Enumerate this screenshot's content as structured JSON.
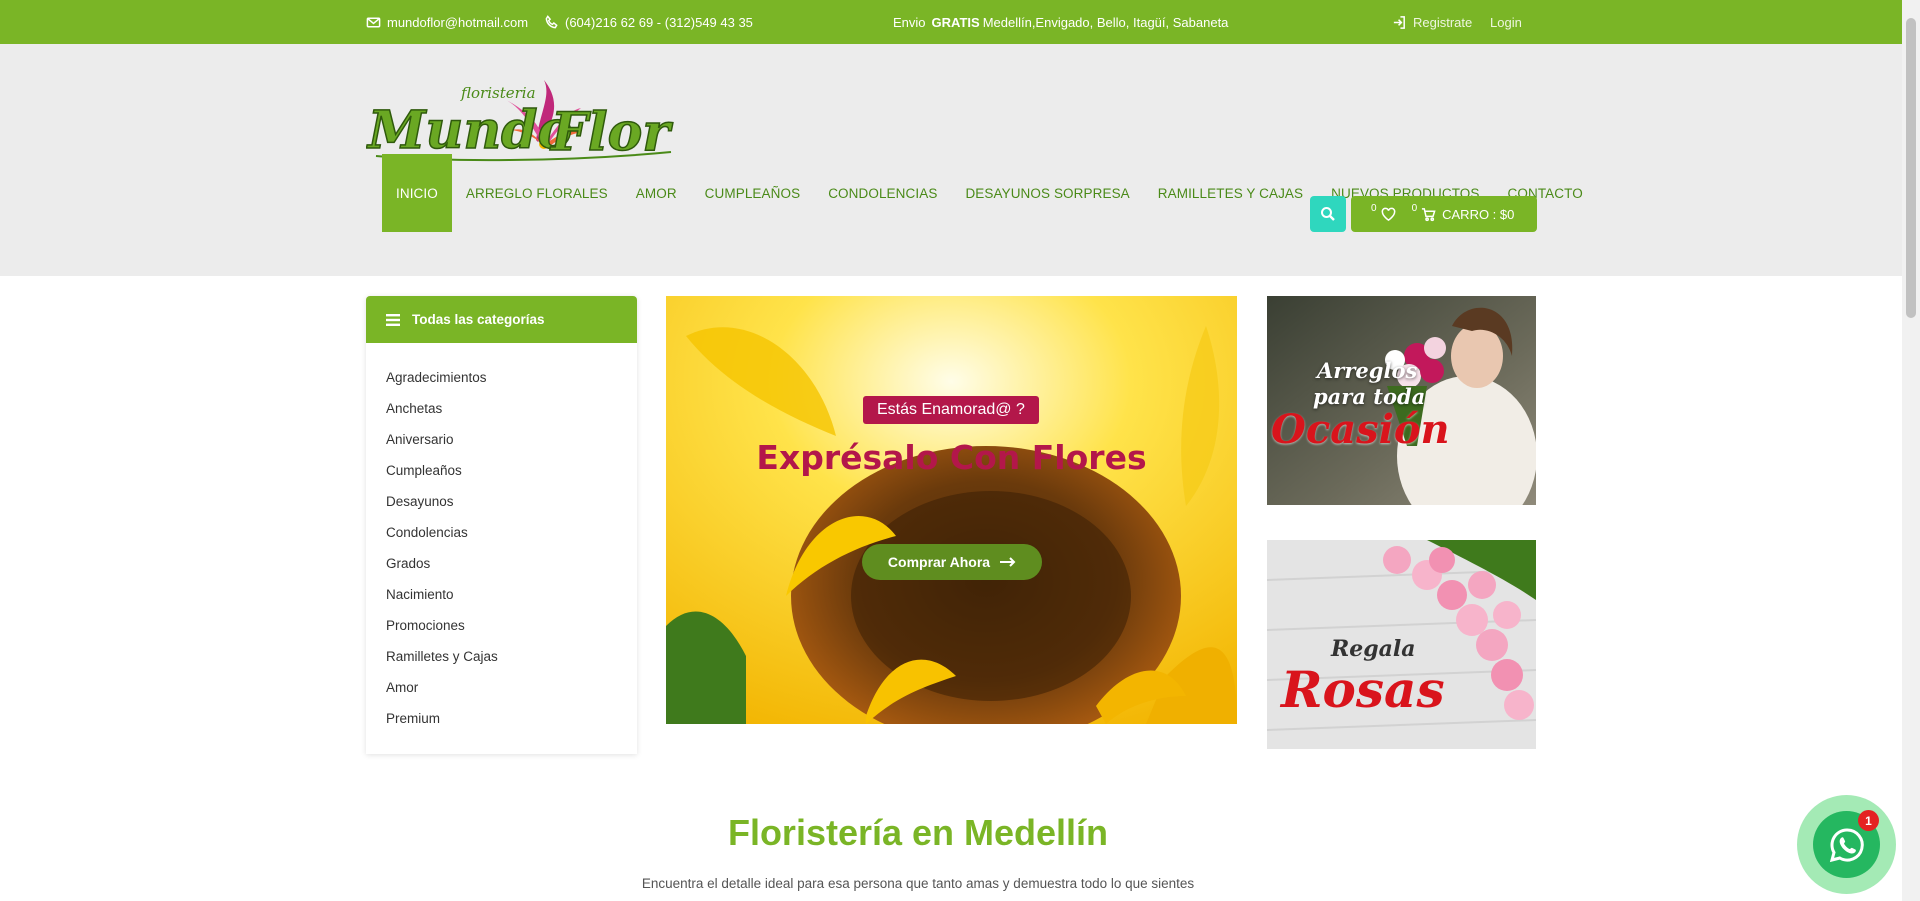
{
  "topbar": {
    "email": "mundoflor@hotmail.com",
    "phone": "(604)216 62 69 - (312)549 43 35",
    "shipping_prefix": "Envio",
    "shipping_bold": "GRATIS",
    "shipping_rest": "Medellín,Envigado, Bello, Itagüí, Sabaneta",
    "register": "Registrate",
    "login": "Login",
    "accent": "#7ab526"
  },
  "logo": {
    "small": "floristeria",
    "main": "Mundo Flor"
  },
  "nav": {
    "items": [
      "INICIO",
      "ARREGLO FLORALES",
      "AMOR",
      "CUMPLEAÑOS",
      "CONDOLENCIAS",
      "DESAYUNOS SORPRESA",
      "RAMILLETES Y CAJAS",
      "NUEVOS PRODUCTOS",
      "CONTACTO"
    ],
    "active": "INICIO"
  },
  "cart": {
    "wishlist_count": "0",
    "cart_count": "0",
    "label": "CARRO : $0",
    "search_icon": "search-icon"
  },
  "sidebar": {
    "title": "Todas las categorías",
    "items": [
      "Agradecimientos",
      "Anchetas",
      "Aniversario",
      "Cumpleaños",
      "Desayunos",
      "Condolencias",
      "Grados",
      "Nacimiento",
      "Promociones",
      "Ramilletes y Cajas",
      "Amor",
      "Premium"
    ]
  },
  "hero": {
    "badge": "Estás Enamorad@ ?",
    "title": "Exprésalo Con Flores",
    "button": "Comprar Ahora",
    "badge_color": "#b3174a"
  },
  "banners": {
    "b1": {
      "line1": "Arreglos",
      "line2": "para toda",
      "line3": "Ocasión"
    },
    "b2": {
      "line1": "Regala",
      "line2": "Rosas"
    }
  },
  "section": {
    "title": "Floristería en Medellín",
    "subtitle": "Encuentra el detalle ideal para esa persona que tanto amas y demuestra todo lo que sientes"
  },
  "whatsapp": {
    "badge": "1",
    "icon": "whatsapp-icon"
  }
}
